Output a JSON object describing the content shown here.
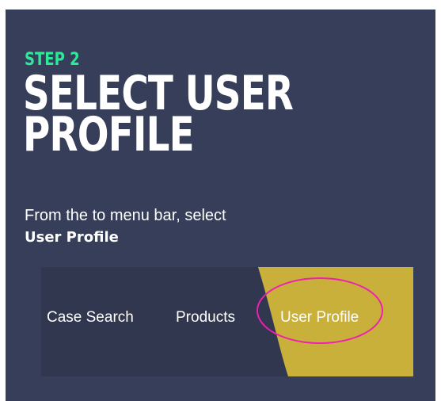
{
  "step": {
    "label": "STEP 2",
    "title_line1": "SELECT USER",
    "title_line2": "PROFILE",
    "description": "From the to menu bar, select",
    "description_bold": "User Profile"
  },
  "nav": {
    "items": [
      {
        "label": "Case Search"
      },
      {
        "label": "Products"
      },
      {
        "label": "User Profile"
      }
    ],
    "highlighted_item": "User Profile"
  },
  "colors": {
    "background": "#363e5a",
    "nav_background": "#30374f",
    "step_label": "#2ee89a",
    "accent": "#c9b03a",
    "highlight_ring": "#ee1fb2",
    "text": "#ffffff"
  }
}
